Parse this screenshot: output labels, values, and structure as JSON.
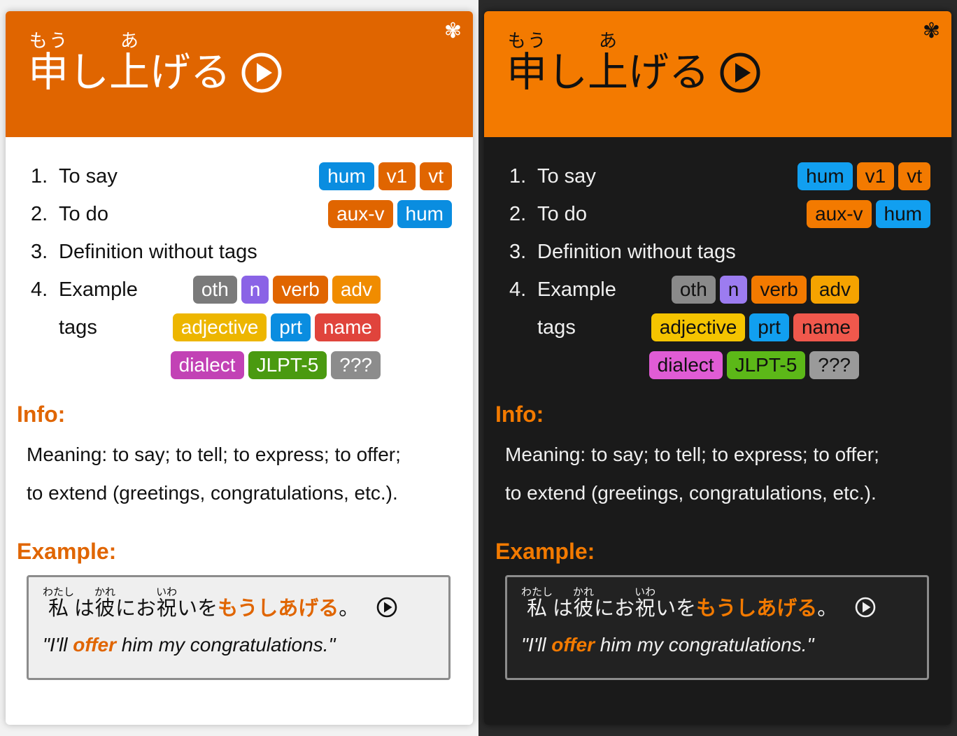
{
  "word": {
    "kanji1": "申",
    "furigana1": "もう",
    "kana1": "し",
    "kanji2": "上",
    "furigana2": "あ",
    "kana2": "げる"
  },
  "header": {
    "flower_icon": "✾"
  },
  "definitions": [
    {
      "num": "1.",
      "text": "To say",
      "tags": [
        "hum",
        "v1",
        "vt"
      ]
    },
    {
      "num": "2.",
      "text": "To do",
      "tags": [
        "aux-v",
        "hum"
      ]
    },
    {
      "num": "3.",
      "text": "Definition without tags",
      "tags": []
    },
    {
      "num": "4.",
      "text": "Example tags",
      "tags": [
        "oth",
        "n",
        "verb",
        "adv",
        "adjective",
        "prt",
        "name",
        "dialect",
        "JLPT-5",
        "???"
      ]
    }
  ],
  "info": {
    "title": "Info:",
    "line1": "Meaning: to say; to tell; to express; to offer;",
    "line2": "to extend (greetings, congratulations, etc.)."
  },
  "example": {
    "title": "Example:",
    "s_kanji1": "私",
    "s_furi1": "わたし",
    "s_kana1": "は",
    "s_kanji2": "彼",
    "s_furi2": "かれ",
    "s_kana2": "にお",
    "s_kanji3": "祝",
    "s_furi3": "いわ",
    "s_kana3": "いを",
    "s_highlight": "もうしあげる",
    "s_end": "。",
    "t_open": "\"I'll ",
    "t_highlight": "offer",
    "t_close": " him my congratulations.\""
  },
  "tag_colors": {
    "light": {
      "hum": "#0a8de0",
      "v1": "#e06500",
      "vt": "#e06500",
      "aux-v": "#e06500",
      "oth": "#7a7a7a",
      "n": "#8a63e6",
      "verb": "#e06500",
      "adv": "#f08c00",
      "adjective": "#edb600",
      "prt": "#0a8de0",
      "name": "#e0443c",
      "dialect": "#c242b5",
      "JLPT-5": "#4a9a10",
      "???": "#8c8c8c"
    },
    "dark": {
      "hum": "#119ff0",
      "v1": "#f37a00",
      "vt": "#f37a00",
      "aux-v": "#f37a00",
      "oth": "#8a8a8a",
      "n": "#9c7cf0",
      "verb": "#f37a00",
      "adv": "#f5a300",
      "adjective": "#f5c400",
      "prt": "#119ff0",
      "name": "#f0584c",
      "dialect": "#e05cd5",
      "JLPT-5": "#5cb818",
      "???": "#9a9a9a"
    }
  }
}
